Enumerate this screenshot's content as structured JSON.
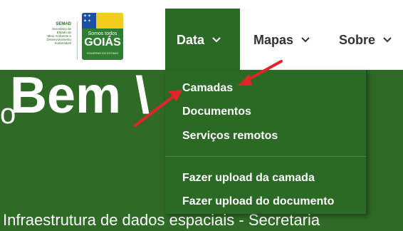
{
  "logo": {
    "semad_abbr": "SEMAD",
    "semad_lines": [
      "Secretaria de",
      "Estado de",
      "Meio Ambiente e",
      "Desenvolvimento",
      "Sustentável"
    ],
    "goias_tagline": "Somos todos",
    "goias_name": "GOIÁS",
    "goias_footer": "GOVERNO DO ESTADO"
  },
  "nav": {
    "data_label": "Data",
    "mapas_label": "Mapas",
    "sobre_label": "Sobre"
  },
  "dropdown": {
    "items": [
      {
        "label": "Camadas"
      },
      {
        "label": "Documentos"
      },
      {
        "label": "Serviços remotos"
      },
      {
        "label": "Fazer upload da camada"
      },
      {
        "label": "Fazer upload do documento"
      }
    ]
  },
  "hero": {
    "title_fragment": "Bem \\",
    "side_fragment": "o",
    "subtitle": "Infraestrutura de dados espaciais - Secretaria"
  },
  "colors": {
    "brand_green": "#2b6a25",
    "hero_green": "#2f6b27",
    "annotation_red": "#e3232a"
  }
}
